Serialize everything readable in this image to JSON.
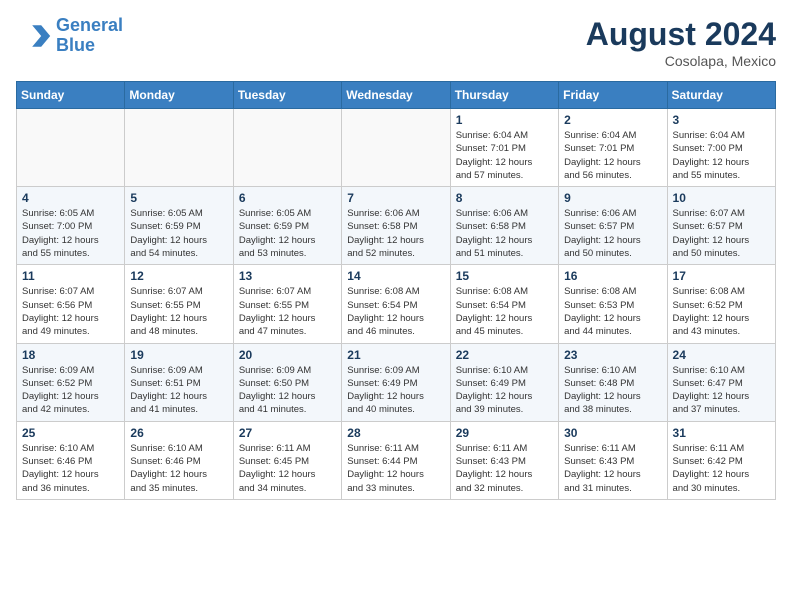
{
  "header": {
    "logo_line1": "General",
    "logo_line2": "Blue",
    "month_title": "August 2024",
    "subtitle": "Cosolapa, Mexico"
  },
  "days_of_week": [
    "Sunday",
    "Monday",
    "Tuesday",
    "Wednesday",
    "Thursday",
    "Friday",
    "Saturday"
  ],
  "weeks": [
    [
      {
        "day": "",
        "info": ""
      },
      {
        "day": "",
        "info": ""
      },
      {
        "day": "",
        "info": ""
      },
      {
        "day": "",
        "info": ""
      },
      {
        "day": "1",
        "info": "Sunrise: 6:04 AM\nSunset: 7:01 PM\nDaylight: 12 hours\nand 57 minutes."
      },
      {
        "day": "2",
        "info": "Sunrise: 6:04 AM\nSunset: 7:01 PM\nDaylight: 12 hours\nand 56 minutes."
      },
      {
        "day": "3",
        "info": "Sunrise: 6:04 AM\nSunset: 7:00 PM\nDaylight: 12 hours\nand 55 minutes."
      }
    ],
    [
      {
        "day": "4",
        "info": "Sunrise: 6:05 AM\nSunset: 7:00 PM\nDaylight: 12 hours\nand 55 minutes."
      },
      {
        "day": "5",
        "info": "Sunrise: 6:05 AM\nSunset: 6:59 PM\nDaylight: 12 hours\nand 54 minutes."
      },
      {
        "day": "6",
        "info": "Sunrise: 6:05 AM\nSunset: 6:59 PM\nDaylight: 12 hours\nand 53 minutes."
      },
      {
        "day": "7",
        "info": "Sunrise: 6:06 AM\nSunset: 6:58 PM\nDaylight: 12 hours\nand 52 minutes."
      },
      {
        "day": "8",
        "info": "Sunrise: 6:06 AM\nSunset: 6:58 PM\nDaylight: 12 hours\nand 51 minutes."
      },
      {
        "day": "9",
        "info": "Sunrise: 6:06 AM\nSunset: 6:57 PM\nDaylight: 12 hours\nand 50 minutes."
      },
      {
        "day": "10",
        "info": "Sunrise: 6:07 AM\nSunset: 6:57 PM\nDaylight: 12 hours\nand 50 minutes."
      }
    ],
    [
      {
        "day": "11",
        "info": "Sunrise: 6:07 AM\nSunset: 6:56 PM\nDaylight: 12 hours\nand 49 minutes."
      },
      {
        "day": "12",
        "info": "Sunrise: 6:07 AM\nSunset: 6:55 PM\nDaylight: 12 hours\nand 48 minutes."
      },
      {
        "day": "13",
        "info": "Sunrise: 6:07 AM\nSunset: 6:55 PM\nDaylight: 12 hours\nand 47 minutes."
      },
      {
        "day": "14",
        "info": "Sunrise: 6:08 AM\nSunset: 6:54 PM\nDaylight: 12 hours\nand 46 minutes."
      },
      {
        "day": "15",
        "info": "Sunrise: 6:08 AM\nSunset: 6:54 PM\nDaylight: 12 hours\nand 45 minutes."
      },
      {
        "day": "16",
        "info": "Sunrise: 6:08 AM\nSunset: 6:53 PM\nDaylight: 12 hours\nand 44 minutes."
      },
      {
        "day": "17",
        "info": "Sunrise: 6:08 AM\nSunset: 6:52 PM\nDaylight: 12 hours\nand 43 minutes."
      }
    ],
    [
      {
        "day": "18",
        "info": "Sunrise: 6:09 AM\nSunset: 6:52 PM\nDaylight: 12 hours\nand 42 minutes."
      },
      {
        "day": "19",
        "info": "Sunrise: 6:09 AM\nSunset: 6:51 PM\nDaylight: 12 hours\nand 41 minutes."
      },
      {
        "day": "20",
        "info": "Sunrise: 6:09 AM\nSunset: 6:50 PM\nDaylight: 12 hours\nand 41 minutes."
      },
      {
        "day": "21",
        "info": "Sunrise: 6:09 AM\nSunset: 6:49 PM\nDaylight: 12 hours\nand 40 minutes."
      },
      {
        "day": "22",
        "info": "Sunrise: 6:10 AM\nSunset: 6:49 PM\nDaylight: 12 hours\nand 39 minutes."
      },
      {
        "day": "23",
        "info": "Sunrise: 6:10 AM\nSunset: 6:48 PM\nDaylight: 12 hours\nand 38 minutes."
      },
      {
        "day": "24",
        "info": "Sunrise: 6:10 AM\nSunset: 6:47 PM\nDaylight: 12 hours\nand 37 minutes."
      }
    ],
    [
      {
        "day": "25",
        "info": "Sunrise: 6:10 AM\nSunset: 6:46 PM\nDaylight: 12 hours\nand 36 minutes."
      },
      {
        "day": "26",
        "info": "Sunrise: 6:10 AM\nSunset: 6:46 PM\nDaylight: 12 hours\nand 35 minutes."
      },
      {
        "day": "27",
        "info": "Sunrise: 6:11 AM\nSunset: 6:45 PM\nDaylight: 12 hours\nand 34 minutes."
      },
      {
        "day": "28",
        "info": "Sunrise: 6:11 AM\nSunset: 6:44 PM\nDaylight: 12 hours\nand 33 minutes."
      },
      {
        "day": "29",
        "info": "Sunrise: 6:11 AM\nSunset: 6:43 PM\nDaylight: 12 hours\nand 32 minutes."
      },
      {
        "day": "30",
        "info": "Sunrise: 6:11 AM\nSunset: 6:43 PM\nDaylight: 12 hours\nand 31 minutes."
      },
      {
        "day": "31",
        "info": "Sunrise: 6:11 AM\nSunset: 6:42 PM\nDaylight: 12 hours\nand 30 minutes."
      }
    ]
  ]
}
